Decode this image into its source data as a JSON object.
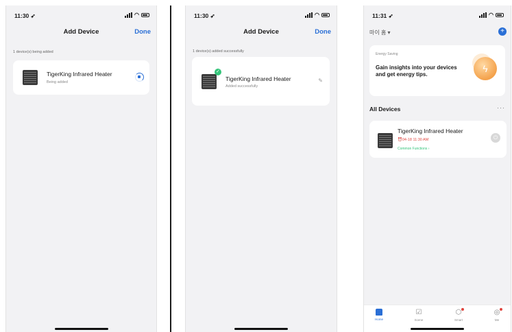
{
  "screens": [
    {
      "time": "11:30",
      "title": "Add Device",
      "done": "Done",
      "caption": "1 device(s) being added",
      "device": {
        "name": "TigerKing Infrared Heater",
        "status": "Being added"
      }
    },
    {
      "time": "11:30",
      "title": "Add Device",
      "done": "Done",
      "caption": "1 device(s) added successfully",
      "device": {
        "name": "TigerKing Infrared Heater",
        "status": "Added successfully"
      }
    },
    {
      "time": "11:31",
      "home": "마이 홈 ▾",
      "energy": {
        "tag": "Energy Saving",
        "message": "Gain insights into your devices and get energy tips."
      },
      "section": "All Devices",
      "more": "···",
      "device": {
        "name": "TigerKing Infrared Heater",
        "alarm": "04-18 11:30 AM",
        "functions": "Common Functions ›"
      },
      "tabs": [
        {
          "label": "Home"
        },
        {
          "label": "Scene"
        },
        {
          "label": "Smart"
        },
        {
          "label": "Me"
        }
      ]
    }
  ],
  "colors": {
    "accent": "#2a6fd6",
    "success": "#35c47a",
    "alert": "#e0443e"
  },
  "icons": [
    "location-arrow-icon",
    "signal-icon",
    "wifi-icon",
    "battery-icon",
    "spinner-icon",
    "check-icon",
    "pencil-icon",
    "plus-icon",
    "bolt-icon",
    "power-icon",
    "home-icon",
    "scene-icon",
    "smart-icon",
    "me-icon"
  ]
}
